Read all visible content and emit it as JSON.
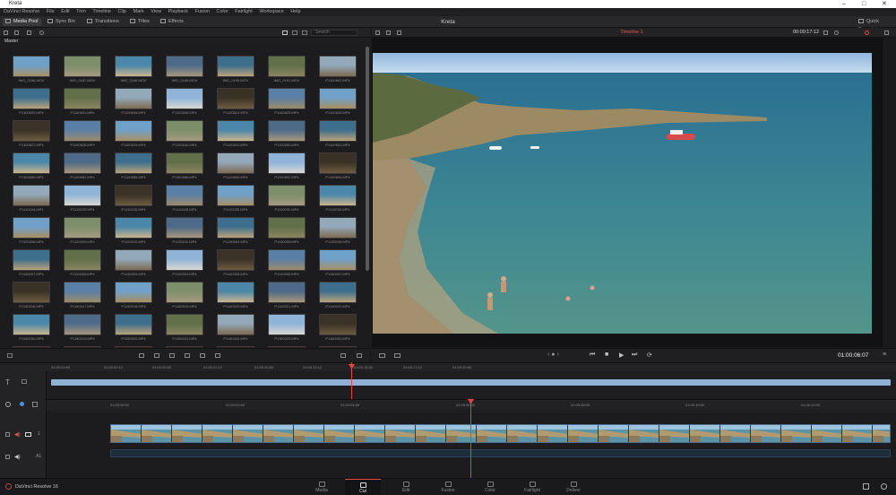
{
  "titlebar": {
    "title": "Kreta"
  },
  "menu": [
    "DaVinci Resolve",
    "File",
    "Edit",
    "Trim",
    "Timeline",
    "Clip",
    "Mark",
    "View",
    "Playback",
    "Fusion",
    "Color",
    "Fairlight",
    "Workspace",
    "Help"
  ],
  "toolbar": {
    "media_pool": "Media Pool",
    "sync_bin": "Sync Bin",
    "transitions": "Transitions",
    "titles": "Titles",
    "effects": "Effects",
    "project_title": "Kreta",
    "quick_export": "Quick Export"
  },
  "pool": {
    "search_placeholder": "Search",
    "bin_name": "Master",
    "clips": [
      "IMG_0186.MOV",
      "IMG_0187.MOV",
      "IMG_0188.MOV",
      "IMG_0189.MOV",
      "IMG_0190.MOV",
      "IMG_0191.MOV",
      "P1100602.MP4",
      "P1100603.MP4",
      "P1100604.MP4",
      "P1100605.MP4",
      "P1100606.MP4",
      "P1100624.MP4",
      "P1100625.MP4",
      "P1100626.MP4",
      "P1100627.MP4",
      "P1100628.MP4",
      "P1100629.MP4",
      "P1100630.MP4",
      "P1100631.MP4",
      "P1100650.MP4",
      "P1100651.MP4",
      "P1100680.MP4",
      "P1100682.MP4",
      "P1100685.MP4",
      "P1100688.MP4",
      "P1100690.MP4",
      "P1100692.MP4",
      "P1100694.MP4",
      "P1110024.MP4",
      "P1110025.MP4",
      "P1110026.MP4",
      "P1110028.MP4",
      "P1110030.MP4",
      "P1110031.MP4",
      "P1110032.MP4",
      "P1120006.MP4",
      "P1120009.MP4",
      "P1120010.MP4",
      "P1120011.MP4",
      "P1130004.MP4",
      "P1130005.MP4",
      "P1130006.MP4",
      "P1130007.MP4",
      "P1130008.MP4",
      "P1130009.MP4",
      "P1140004.MP4",
      "P1140005.MP4",
      "P1140006.MP4",
      "P1140007.MP4",
      "P1140016.MP4",
      "P1140017.MP4",
      "P1140018.MP4",
      "P1140019.MP4",
      "P1140020.MP4",
      "P1140021.MP4",
      "P1140022.MP4",
      "P1140030.MP4",
      "P1150019.MP4",
      "P1150020.MP4",
      "P1150021.MP4",
      "P1150022.MP4",
      "P1150023.MP4",
      "P1160001.MP4",
      "",
      "",
      "",
      "",
      "",
      "",
      ""
    ]
  },
  "viewer": {
    "timeline_name": "Timeline 1",
    "source_tc": "00:00:17:12",
    "playhead_tc": "01:00:06:07"
  },
  "timeline": {
    "upper_ruler": [
      "01:00:00:00",
      "01:00:02:12",
      "01:00:05:00",
      "01:00:07:12",
      "01:00:10:00",
      "01:00:12:12",
      "01:00:15:00",
      "01:00:17:12",
      "01:00:20:00"
    ],
    "lower_ruler": [
      "01:00:00:00",
      "01:00:02:00",
      "01:00:04:00",
      "01:00:06:00",
      "01:00:08:00",
      "01:00:10:00",
      "01:00:12:00",
      "01:00:14:00"
    ],
    "video_track": "1",
    "audio_track": "A1"
  },
  "footer": {
    "app_name": "DaVinci Resolve 16",
    "pages": [
      "Media",
      "Cut",
      "Edit",
      "Fusion",
      "Color",
      "Fairlight",
      "Deliver"
    ],
    "active_page": "Cut"
  },
  "colors": {
    "accent_red": "#e2453a",
    "clip_blue": "#8fb1d6",
    "clip_track_blue": "#7a9cbf"
  }
}
